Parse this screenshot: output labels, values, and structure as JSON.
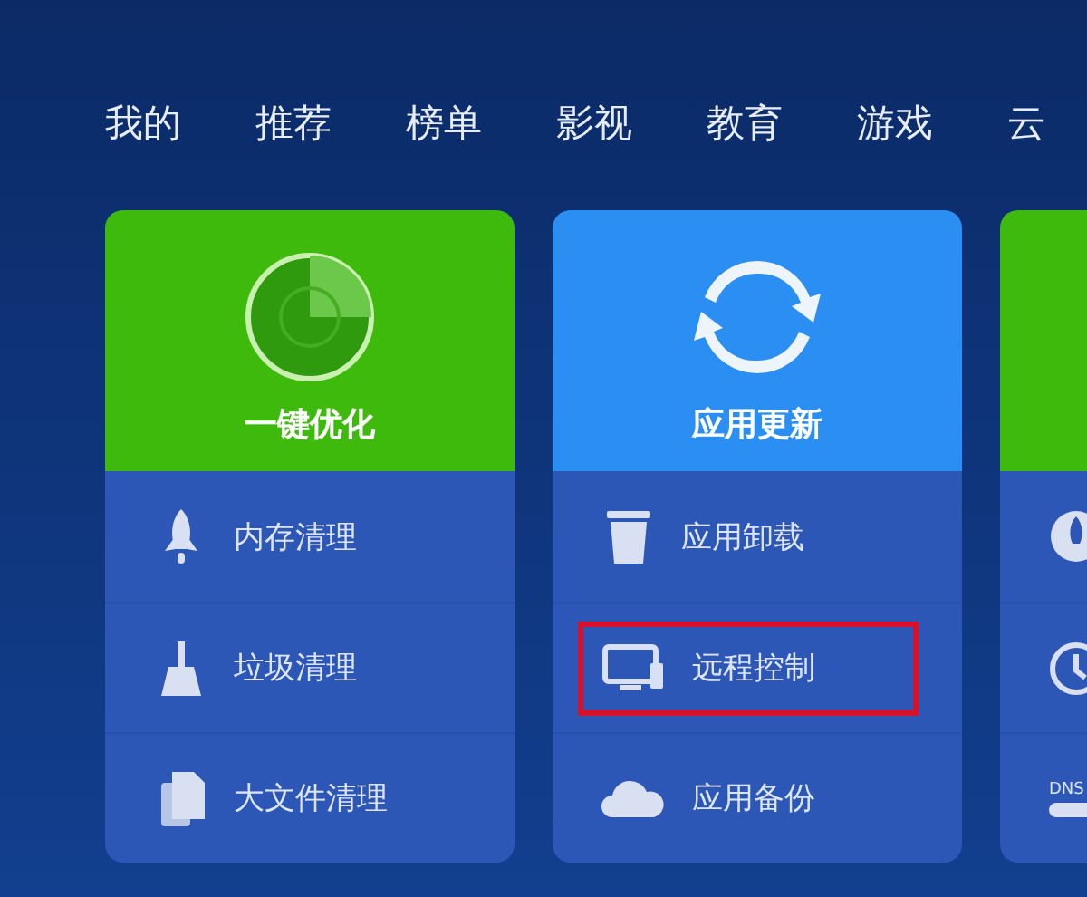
{
  "tabs": [
    {
      "label": "我的"
    },
    {
      "label": "推荐"
    },
    {
      "label": "榜单"
    },
    {
      "label": "影视"
    },
    {
      "label": "教育"
    },
    {
      "label": "游戏"
    },
    {
      "label": "云"
    }
  ],
  "cards": [
    {
      "title": "一键优化",
      "color": "#3dba0c",
      "items": [
        {
          "label": "内存清理",
          "highlighted": false
        },
        {
          "label": "垃圾清理",
          "highlighted": false
        },
        {
          "label": "大文件清理",
          "highlighted": false
        }
      ]
    },
    {
      "title": "应用更新",
      "color": "#2b8ef2",
      "items": [
        {
          "label": "应用卸载",
          "highlighted": false
        },
        {
          "label": "远程控制",
          "highlighted": true
        },
        {
          "label": "应用备份",
          "highlighted": false
        }
      ]
    },
    {
      "color": "#3dba0c",
      "items": [
        {
          "highlighted": false
        },
        {
          "highlighted": false
        },
        {
          "label": "DNS",
          "highlighted": false
        }
      ]
    }
  ]
}
